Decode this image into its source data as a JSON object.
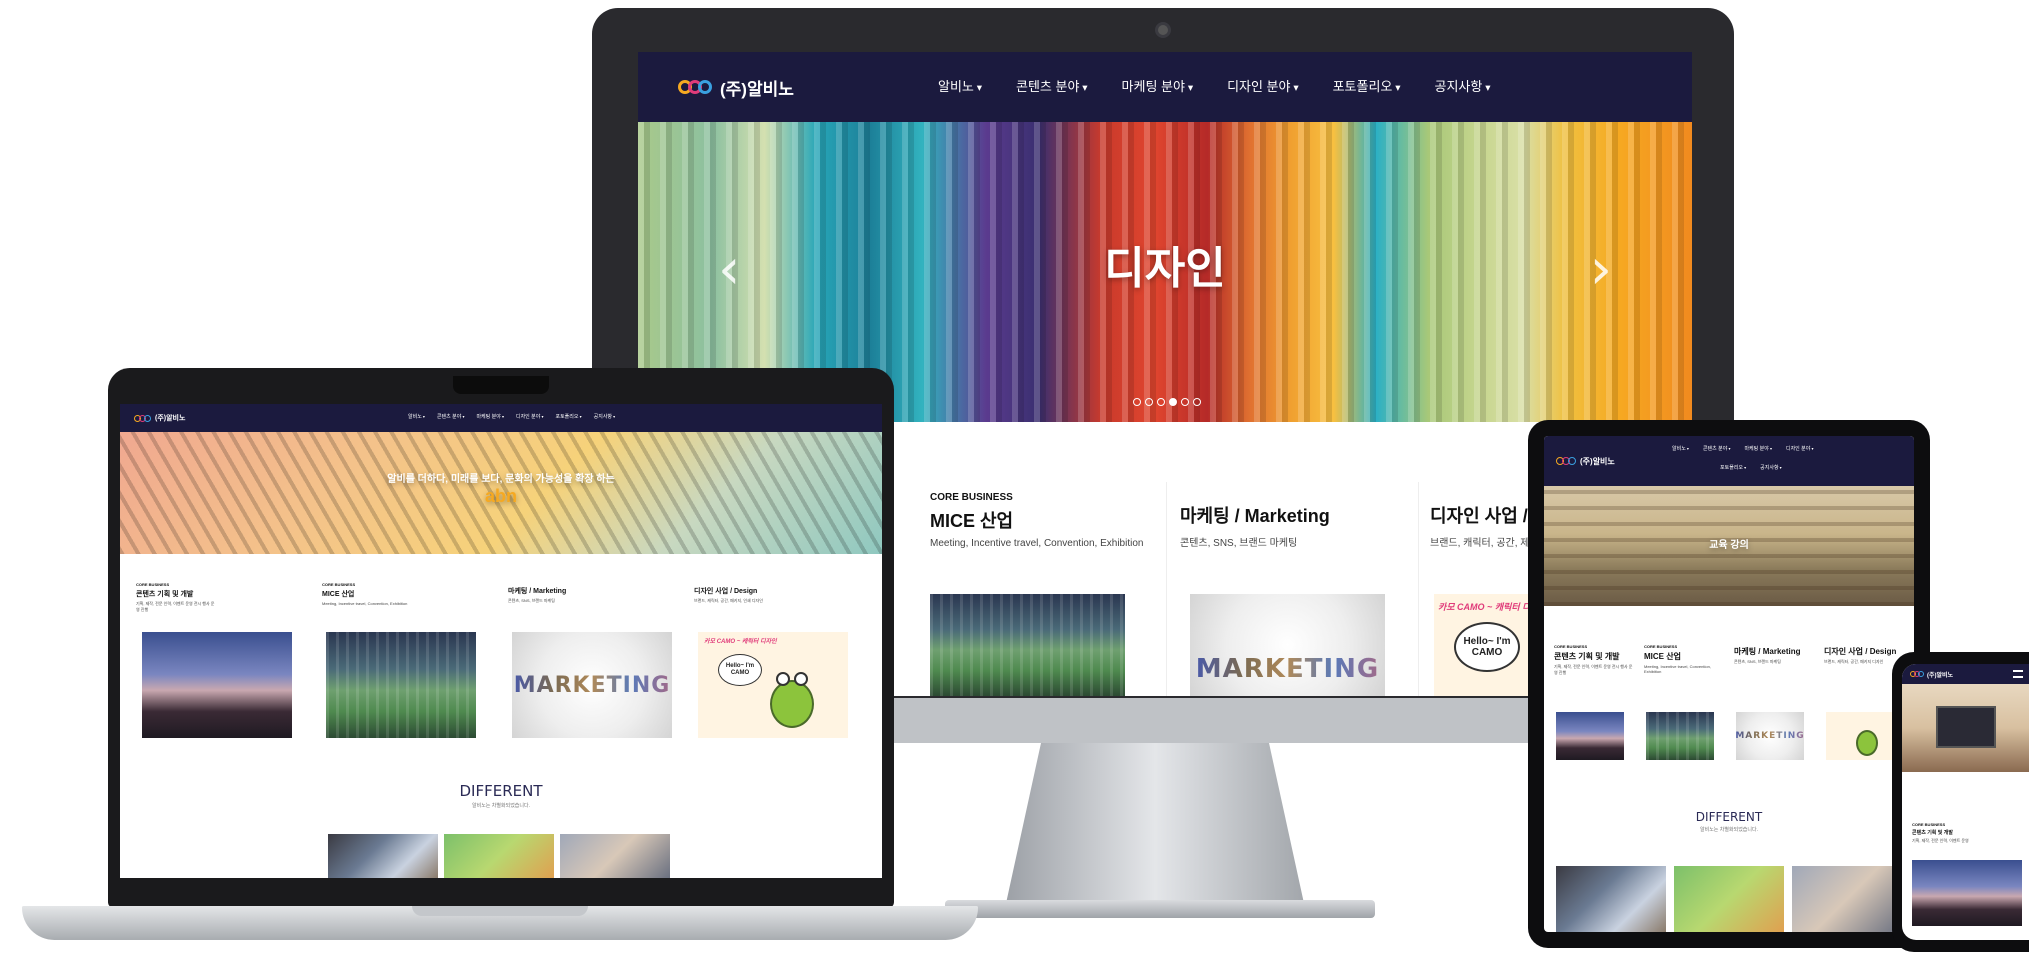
{
  "brand": {
    "name": "(주)알비노",
    "logo_text": "abn"
  },
  "colors": {
    "nav": "#1b1a3e",
    "accent_pink": "#e03b7a",
    "accent_blue": "#3aa0e0",
    "accent_yellow": "#f6a921"
  },
  "nav": {
    "items": [
      "알비노",
      "콘텐츠 분야",
      "마케팅 분야",
      "디자인 분야",
      "포토폴리오",
      "공지사항"
    ]
  },
  "monitor": {
    "hero_title": "디자인",
    "prev": "‹",
    "next": "›",
    "carousel": {
      "count": 6,
      "active": 4
    },
    "cards": [
      {
        "kicker": "CORE BUSINESS",
        "title": "MICE 산업",
        "desc": "Meeting, Incentive travel, Convention, Exhibition"
      },
      {
        "kicker": "",
        "title": "마케팅 / Marketing",
        "desc": "콘텐츠, SNS, 브랜드 마케팅"
      },
      {
        "kicker": "",
        "title": "디자인 사업 /",
        "desc": "브랜드, 캐릭터, 공간, 제"
      }
    ],
    "mkt_word": "MARKETING",
    "camo": {
      "headline": "카모 CAMO ~ 캐릭터 디자인",
      "bubble": "Hello~ I'm CAMO"
    }
  },
  "laptop": {
    "hero_title": "알비를 더하다, 미래를 보다, 문화의 가능성을 확장 하는",
    "hero_logo": "abn",
    "cards": [
      {
        "kicker": "CORE BUSINESS",
        "title": "콘텐츠 기획 및 개발",
        "desc": "기획, 제작, 전문 인력, 이벤트 운영 전시 행사 운영 진행"
      },
      {
        "kicker": "CORE BUSINESS",
        "title": "MICE 산업",
        "desc": "Meeting, Incentive travel, Convention, Exhibition"
      },
      {
        "kicker": "",
        "title": "마케팅 / Marketing",
        "desc": "콘텐츠, SNS, 브랜드 마케팅"
      },
      {
        "kicker": "",
        "title": "디자인 사업 / Design",
        "desc": "브랜드, 캐릭터, 공간, 패키지, 인쇄 디자인"
      }
    ],
    "mkt_word": "MARKETING",
    "camo": {
      "headline": "카모 CAMO ~ 캐릭터 디자인",
      "bubble": "Hello~ I'm CAMO"
    },
    "different": {
      "title": "DIFFERENT",
      "sub": "알비노는 차별화되었습니다."
    }
  },
  "tablet": {
    "hero_title": "교육 강의",
    "nav_row2": [
      "포토폴리오",
      "공지사항"
    ],
    "cards": [
      {
        "kicker": "CORE BUSINESS",
        "title": "콘텐츠 기획 및 개발",
        "desc": "기획, 제작, 전문 인력, 이벤트 운영 전시 행사 운영 진행"
      },
      {
        "kicker": "CORE BUSINESS",
        "title": "MICE 산업",
        "desc": "Meeting, Incentive travel, Convention, Exhibition"
      },
      {
        "kicker": "",
        "title": "마케팅 / Marketing",
        "desc": "콘텐츠, SNS, 브랜드 마케팅"
      },
      {
        "kicker": "",
        "title": "디자인 사업 / Design",
        "desc": "브랜드, 캐릭터, 공간, 패키지 디자인"
      }
    ],
    "mkt_word": "MARKETING",
    "different": {
      "title": "DIFFERENT",
      "sub": "알비노는 차별화되었습니다."
    }
  },
  "phone": {
    "card": {
      "kicker": "CORE BUSINESS",
      "title": "콘텐츠 기획 및 개발",
      "desc": "기획, 제작, 전문 인력, 이벤트 운영"
    }
  }
}
